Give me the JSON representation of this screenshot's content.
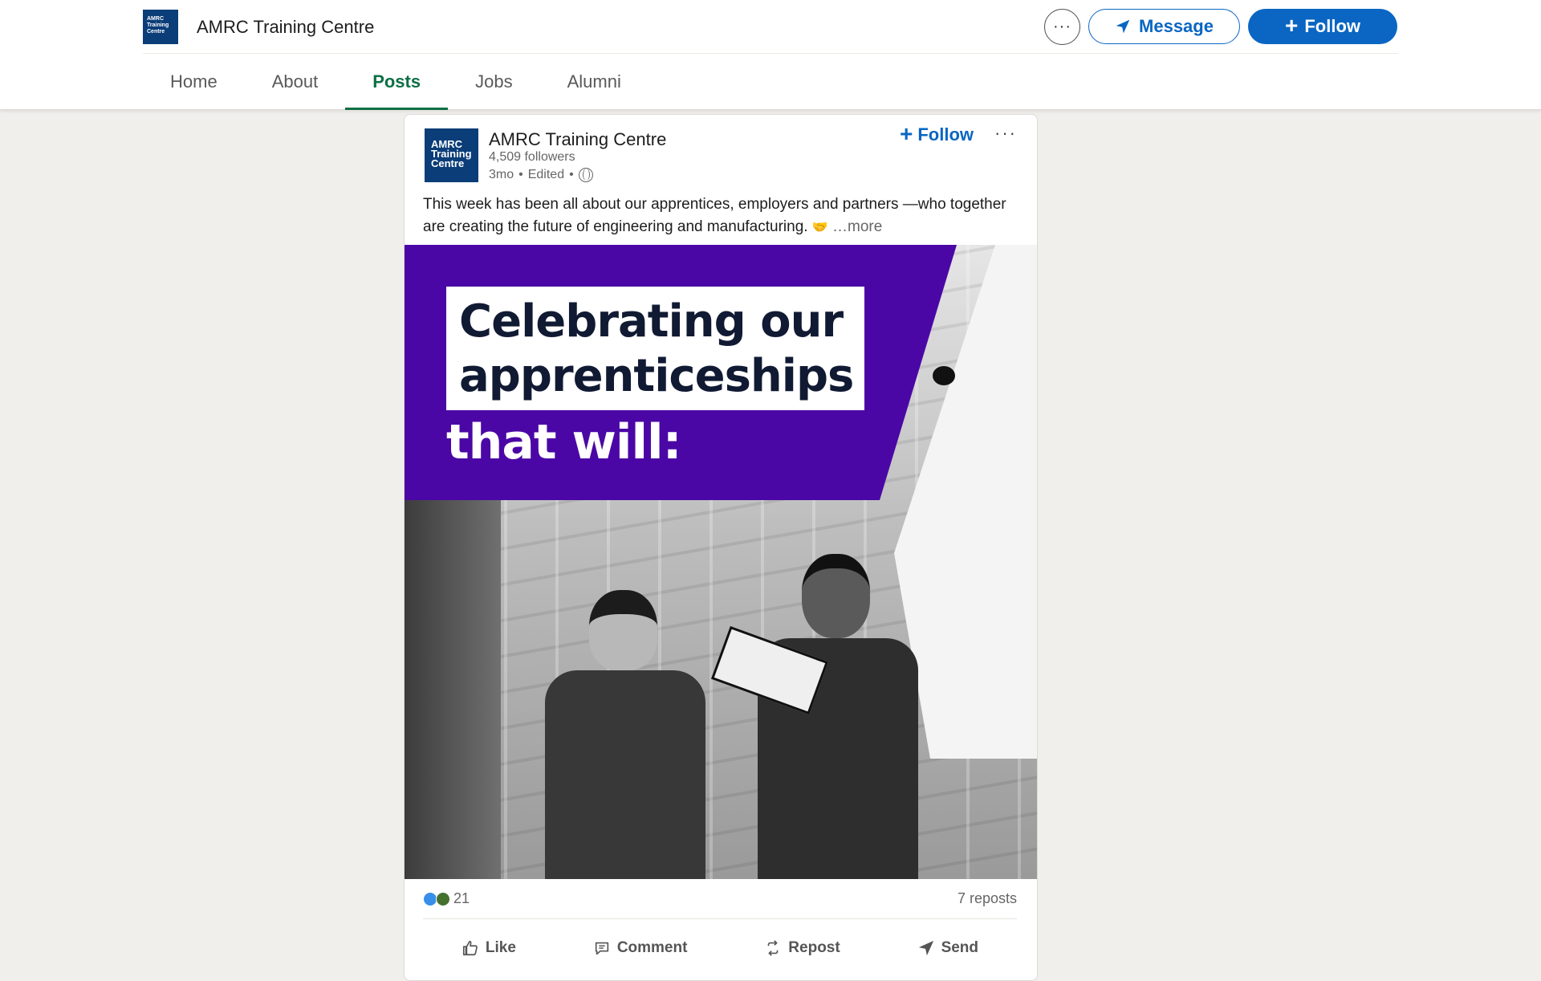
{
  "header": {
    "org_name": "AMRC Training Centre",
    "logo_text": "AMRC Training Centre",
    "more_label": "···",
    "message_label": "Message",
    "follow_label": "Follow"
  },
  "tabs": [
    {
      "label": "Home",
      "active": false
    },
    {
      "label": "About",
      "active": false
    },
    {
      "label": "Posts",
      "active": true
    },
    {
      "label": "Jobs",
      "active": false
    },
    {
      "label": "Alumni",
      "active": false
    }
  ],
  "post": {
    "logo_text": "AMRC Training Centre",
    "author": "AMRC Training Centre",
    "followers": "4,509 followers",
    "time": "3mo",
    "edited": "Edited",
    "follow_label": "Follow",
    "menu_label": "···",
    "text": "This week has been all about our apprentices, employers and partners —who together are creating the future of engineering and manufacturing.",
    "more_label": "…more",
    "image": {
      "headline_line1": "Celebrating our",
      "headline_line2": "apprenticeships",
      "headline_line3": "that will:"
    },
    "reaction_count": "21",
    "reposts": "7 reposts",
    "actions": {
      "like": "Like",
      "comment": "Comment",
      "repost": "Repost",
      "send": "Send"
    }
  },
  "colors": {
    "brand_blue": "#0a66c2",
    "active_tab": "#0d6f45",
    "banner_purple": "#4b07a6",
    "logo_navy": "#0b3d78"
  },
  "icons": {
    "message": "send-arrow-icon",
    "globe": "globe-icon",
    "like": "thumbs-up-icon",
    "comment": "comment-bubble-icon",
    "repost": "repost-arrows-icon",
    "send": "send-arrow-icon"
  }
}
